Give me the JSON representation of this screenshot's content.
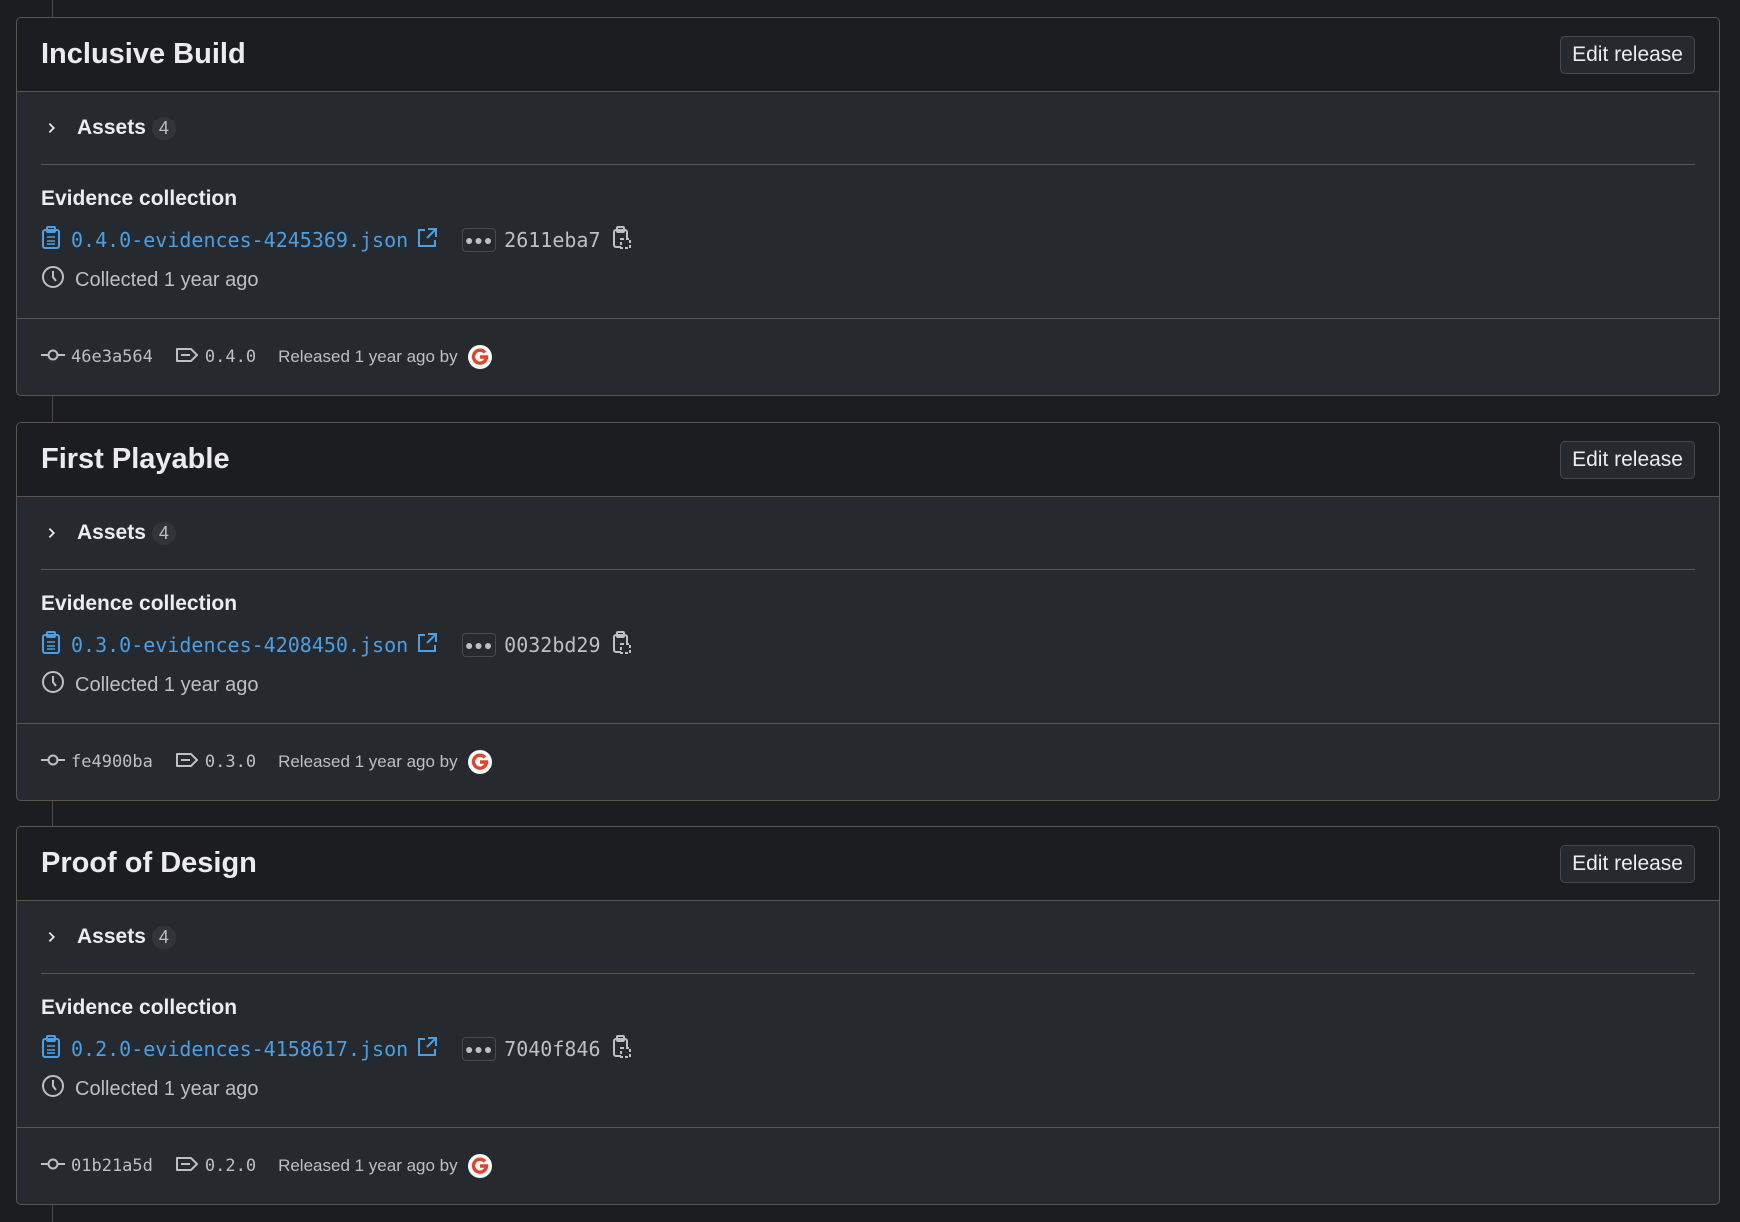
{
  "releases": [
    {
      "title": "Inclusive Build",
      "edit_label": "Edit release",
      "assets_label": "Assets",
      "assets_count": "4",
      "evidence_title": "Evidence collection",
      "evidence_file": "0.4.0-evidences-4245369.json",
      "evidence_hash": "2611eba7",
      "collected": "Collected 1 year ago",
      "commit": "46e3a564",
      "tag": "0.4.0",
      "released": "Released 1 year ago by"
    },
    {
      "title": "First Playable",
      "edit_label": "Edit release",
      "assets_label": "Assets",
      "assets_count": "4",
      "evidence_title": "Evidence collection",
      "evidence_file": "0.3.0-evidences-4208450.json",
      "evidence_hash": "0032bd29",
      "collected": "Collected 1 year ago",
      "commit": "fe4900ba",
      "tag": "0.3.0",
      "released": "Released 1 year ago by"
    },
    {
      "title": "Proof of Design",
      "edit_label": "Edit release",
      "assets_label": "Assets",
      "assets_count": "4",
      "evidence_title": "Evidence collection",
      "evidence_file": "0.2.0-evidences-4158617.json",
      "evidence_hash": "7040f846",
      "collected": "Collected 1 year ago",
      "commit": "01b21a5d",
      "tag": "0.2.0",
      "released": "Released 1 year ago by"
    }
  ],
  "icons": {
    "chevron": "chevron-right-icon",
    "evidence": "clipboard-icon",
    "external": "external-link-icon",
    "ellipsis": "ellipsis-icon",
    "copy": "copy-icon",
    "clock": "clock-icon",
    "commit": "commit-icon",
    "tag": "tag-icon"
  },
  "colors": {
    "link": "#4a9fe5",
    "background": "#1c1d20",
    "card": "#26292d"
  }
}
